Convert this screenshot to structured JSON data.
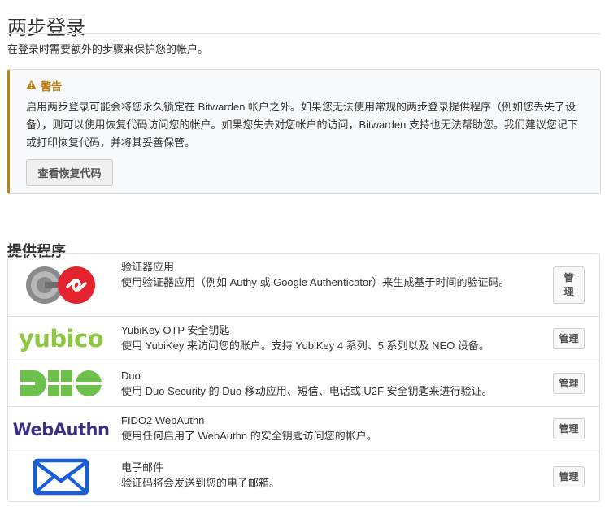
{
  "page": {
    "title": "两步登录",
    "intro": "在登录时需要额外的步骤来保护您的帐户。"
  },
  "warning": {
    "heading": "警告",
    "body": "启用两步登录可能会将您永久锁定在 Bitwarden 帐户之外。如果您无法使用常规的两步登录提供程序（例如您丢失了设备），则可以使用恢复代码访问您的帐户。如果您失去对您帐户的访问，Bitwarden 支持也无法帮助您。我们建议您记下或打印恢复代码，并将其妥善保管。",
    "button_label": "查看恢复代码",
    "color": "#bf7e16"
  },
  "providers": {
    "section_title": "提供程序",
    "manage_label": "管理",
    "items": [
      {
        "name": "验证器应用",
        "description": "使用验证器应用（例如 Authy 或 Google Authenticator）来生成基于时间的验证码。",
        "logo": "authenticator-app-logo"
      },
      {
        "name": "YubiKey OTP 安全钥匙",
        "description": "使用 YubiKey 来访问您的账户。支持 YubiKey 4 系列、5 系列以及 NEO 设备。",
        "logo": "yubico-logo",
        "logo_text": "yubico",
        "logo_color": "#8dc63f"
      },
      {
        "name": "Duo",
        "description": "使用 Duo Security 的 Duo 移动应用、短信、电话或 U2F 安全钥匙来进行验证。",
        "logo": "duo-logo",
        "logo_color": "#6dc04b"
      },
      {
        "name": "FIDO2 WebAuthn",
        "description": "使用任何启用了 WebAuthn 的安全钥匙访问您的帐户。",
        "logo": "webauthn-logo",
        "logo_text": "WebAuthn",
        "logo_color": "#3a2f87"
      },
      {
        "name": "电子邮件",
        "description": "验证码将会发送到您的电子邮箱。",
        "logo": "email-envelope-logo",
        "logo_color": "#175ddc"
      }
    ]
  }
}
